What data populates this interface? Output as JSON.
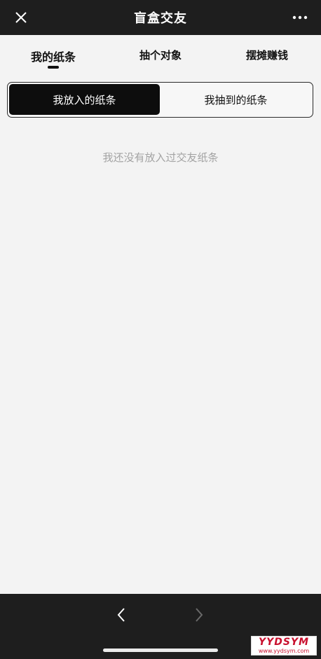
{
  "header": {
    "title": "盲盒交友",
    "close_icon": "close-icon",
    "more_icon": "more-dots-icon"
  },
  "tabs": [
    {
      "label": "我的纸条",
      "active": true
    },
    {
      "label": "抽个对象",
      "active": false
    },
    {
      "label": "摆摊赚钱",
      "active": false
    }
  ],
  "segment": {
    "options": [
      {
        "label": "我放入的纸条",
        "active": true
      },
      {
        "label": "我抽到的纸条",
        "active": false
      }
    ]
  },
  "empty_message": "我还没有放入过交友纸条",
  "bottom_nav": {
    "back_icon": "chevron-left-icon",
    "forward_icon": "chevron-right-icon",
    "forward_enabled": false
  },
  "watermark": {
    "brand": "YYDSYM",
    "url": "www.yydsym.com"
  },
  "colors": {
    "bar_bg": "#1e1e1e",
    "page_bg": "#f3f3f3",
    "active_segment": "#0d0d0d",
    "empty_text": "#a3a3a3",
    "watermark_red": "#c8102e"
  }
}
